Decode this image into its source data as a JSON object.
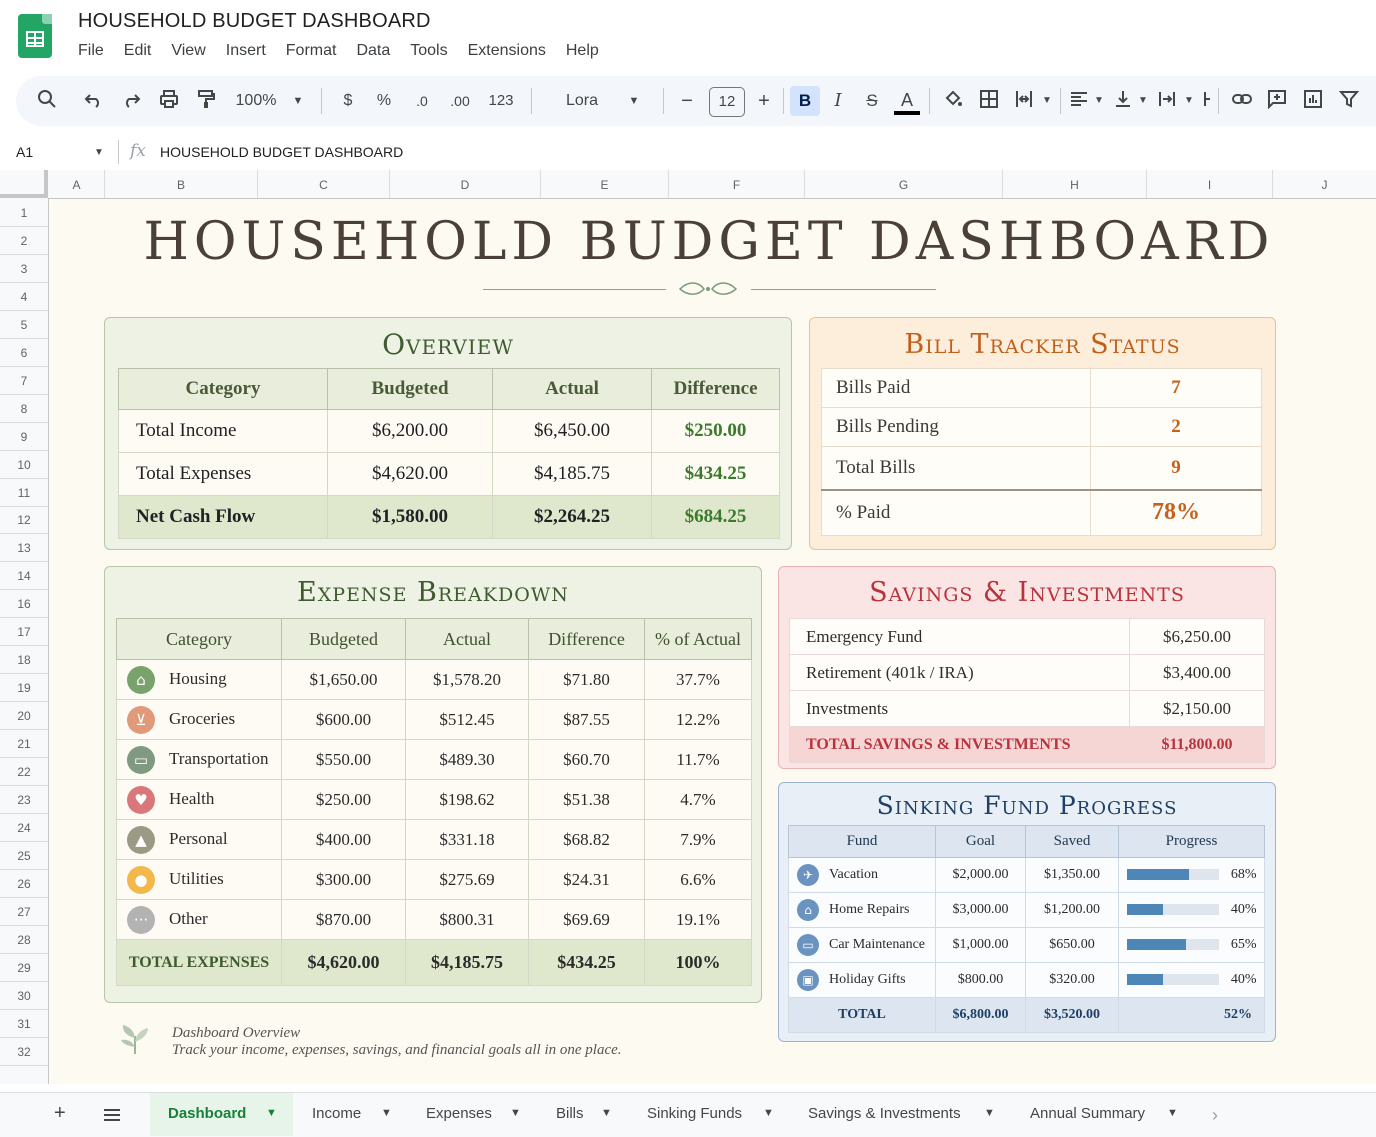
{
  "app": {
    "doc_title": "HOUSEHOLD BUDGET DASHBOARD",
    "menu": [
      "File",
      "Edit",
      "View",
      "Insert",
      "Format",
      "Data",
      "Tools",
      "Extensions",
      "Help"
    ]
  },
  "toolbar": {
    "zoom": "100%",
    "currency": "$",
    "percent": "%",
    "dec_decrease": ".0",
    "dec_increase": ".00",
    "number_format": "123",
    "font": "Lora",
    "font_size": "12",
    "bold": "B",
    "italic": "I",
    "text_color": "A"
  },
  "formula_bar": {
    "cell_ref": "A1",
    "fx": "fx",
    "content": "HOUSEHOLD BUDGET DASHBOARD"
  },
  "grid": {
    "columns": [
      "A",
      "B",
      "C",
      "D",
      "E",
      "F",
      "G",
      "H",
      "I",
      "J"
    ],
    "rows": [
      "1",
      "2",
      "3",
      "4",
      "5",
      "6",
      "7",
      "8",
      "9",
      "10",
      "11",
      "12",
      "13",
      "14",
      "16",
      "17",
      "18",
      "19",
      "20",
      "21",
      "22",
      "23",
      "24",
      "25",
      "26",
      "27",
      "28",
      "29",
      "30",
      "31",
      "32"
    ]
  },
  "dashboard": {
    "title": "HOUSEHOLD BUDGET DASHBOARD",
    "overview": {
      "title": "Overview",
      "headers": [
        "Category",
        "Budgeted",
        "Actual",
        "Difference"
      ],
      "rows": [
        [
          "Total Income",
          "$6,200.00",
          "$6,450.00",
          "$250.00"
        ],
        [
          "Total Expenses",
          "$4,620.00",
          "$4,185.75",
          "$434.25"
        ]
      ],
      "total": [
        "Net Cash Flow",
        "$1,580.00",
        "$2,264.25",
        "$684.25"
      ]
    },
    "bill_tracker": {
      "title": "Bill Tracker Status",
      "rows": [
        [
          "Bills Paid",
          "7"
        ],
        [
          "Bills Pending",
          "2"
        ],
        [
          "Total Bills",
          "9"
        ],
        [
          "% Paid",
          "78%"
        ]
      ]
    },
    "expense_breakdown": {
      "title": "Expense Breakdown",
      "headers": [
        "Category",
        "Budgeted",
        "Actual",
        "Difference",
        "% of Actual"
      ],
      "rows": [
        {
          "icon": "home-icon",
          "color": "#7aa26d",
          "category": "Housing",
          "budgeted": "$1,650.00",
          "actual": "$1,578.20",
          "difference": "$71.80",
          "pct": "37.7%"
        },
        {
          "icon": "cart-icon",
          "color": "#e09a7a",
          "category": "Groceries",
          "budgeted": "$600.00",
          "actual": "$512.45",
          "difference": "$87.55",
          "pct": "12.2%"
        },
        {
          "icon": "car-icon",
          "color": "#7f9a80",
          "category": "Transportation",
          "budgeted": "$550.00",
          "actual": "$489.30",
          "difference": "$60.70",
          "pct": "11.7%"
        },
        {
          "icon": "heart-icon",
          "color": "#d9777a",
          "category": "Health",
          "budgeted": "$250.00",
          "actual": "$198.62",
          "difference": "$51.38",
          "pct": "4.7%"
        },
        {
          "icon": "graduation-cap-icon",
          "color": "#9a9a86",
          "category": "Personal",
          "budgeted": "$400.00",
          "actual": "$331.18",
          "difference": "$68.82",
          "pct": "7.9%"
        },
        {
          "icon": "lightbulb-icon",
          "color": "#f2b84b",
          "category": "Utilities",
          "budgeted": "$300.00",
          "actual": "$275.69",
          "difference": "$24.31",
          "pct": "6.6%"
        },
        {
          "icon": "more-icon",
          "color": "#b3b3b3",
          "category": "Other",
          "budgeted": "$870.00",
          "actual": "$800.31",
          "difference": "$69.69",
          "pct": "19.1%"
        }
      ],
      "total": [
        "TOTAL EXPENSES",
        "$4,620.00",
        "$4,185.75",
        "$434.25",
        "100%"
      ]
    },
    "savings": {
      "title": "Savings & Investments",
      "rows": [
        [
          "Emergency Fund",
          "$6,250.00"
        ],
        [
          "Retirement (401k / IRA)",
          "$3,400.00"
        ],
        [
          "Investments",
          "$2,150.00"
        ]
      ],
      "total": [
        "TOTAL SAVINGS & INVESTMENTS",
        "$11,800.00"
      ]
    },
    "sinking_funds": {
      "title": "Sinking Fund Progress",
      "headers": [
        "Fund",
        "Goal",
        "Saved",
        "Progress"
      ],
      "rows": [
        {
          "icon": "airplane-icon",
          "fund": "Vacation",
          "goal": "$2,000.00",
          "saved": "$1,350.00",
          "progress": 0.68,
          "pct": "68%"
        },
        {
          "icon": "home-icon",
          "fund": "Home Repairs",
          "goal": "$3,000.00",
          "saved": "$1,200.00",
          "progress": 0.4,
          "pct": "40%"
        },
        {
          "icon": "car-icon",
          "fund": "Car Maintenance",
          "goal": "$1,000.00",
          "saved": "$650.00",
          "progress": 0.65,
          "pct": "65%"
        },
        {
          "icon": "gift-icon",
          "fund": "Holiday Gifts",
          "goal": "$800.00",
          "saved": "$320.00",
          "progress": 0.4,
          "pct": "40%"
        }
      ],
      "total": [
        "TOTAL",
        "$6,800.00",
        "$3,520.00",
        "52%"
      ]
    },
    "note": {
      "title": "Dashboard Overview",
      "text": "Track your income, expenses, savings, and financial goals all in one place."
    }
  },
  "tabs": [
    "Dashboard",
    "Income",
    "Expenses",
    "Bills",
    "Sinking Funds",
    "Savings & Investments",
    "Annual Summary"
  ],
  "colors": {
    "accent_green": "#3a7a2a",
    "accent_orange": "#c8601c",
    "accent_red": "#b8333b",
    "accent_blue": "#4f86b8",
    "active_tab": "#188038"
  }
}
